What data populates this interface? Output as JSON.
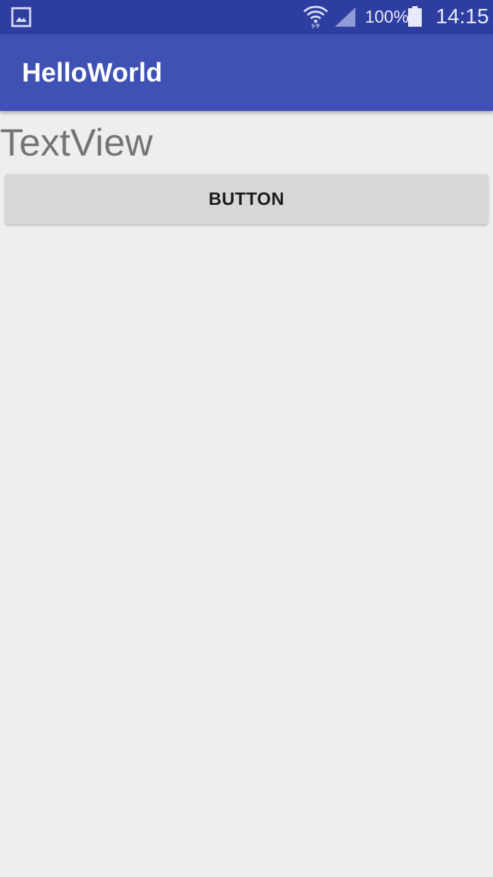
{
  "status_bar": {
    "notification_icon": "gallery-icon",
    "wifi_icon": "wifi-icon",
    "signal_icon": "signal-icon",
    "battery_percent": "100%",
    "battery_level": 1.0,
    "battery_icon": "battery-icon",
    "time": "14:15",
    "background_color": "#2e3da0"
  },
  "app_bar": {
    "title": "HelloWorld",
    "background_color": "#3f51b5"
  },
  "content": {
    "text_view": "TextView",
    "button_label": "BUTTON",
    "background_color": "#eeeeee"
  }
}
